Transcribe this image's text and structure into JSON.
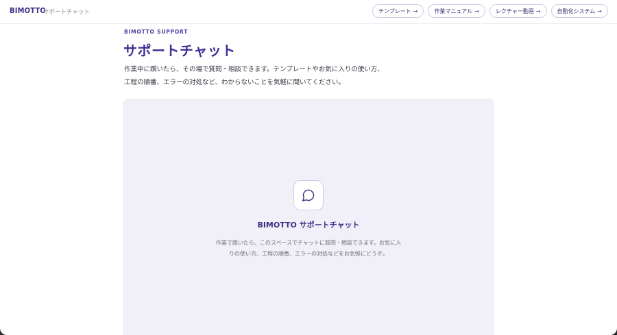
{
  "header": {
    "brand": "BIMOTTO",
    "brand_sub": "サポートチャット",
    "nav": [
      {
        "label": "テンプレート",
        "arrow": "→"
      },
      {
        "label": "作業マニュアル",
        "arrow": "→"
      },
      {
        "label": "レクチャー動画",
        "arrow": "→"
      },
      {
        "label": "自動化システム",
        "arrow": "→"
      }
    ]
  },
  "main": {
    "eyebrow": "BIMOTTO SUPPORT",
    "title": "サポートチャット",
    "description_lines": [
      "作業中に躓いたら、その場で質問・相談できます。テンプレートやお気に入りの使い方、",
      "工程の順番、エラーの対処など、わからないことを気軽に聞いてください。"
    ]
  },
  "chat": {
    "icon": "chat-bubble-icon",
    "title": "BIMOTTO サポートチャット",
    "description": "作業で躓いたら、このスペースでチャットに質問・相談できます。お気に入りの使い方、工程の順番、エラーの対処などをお気軽にどうぞ。"
  },
  "colors": {
    "brand": "#3d2f93",
    "panel_bg": "#f1f0f8",
    "button_border": "#cfcbe6"
  }
}
